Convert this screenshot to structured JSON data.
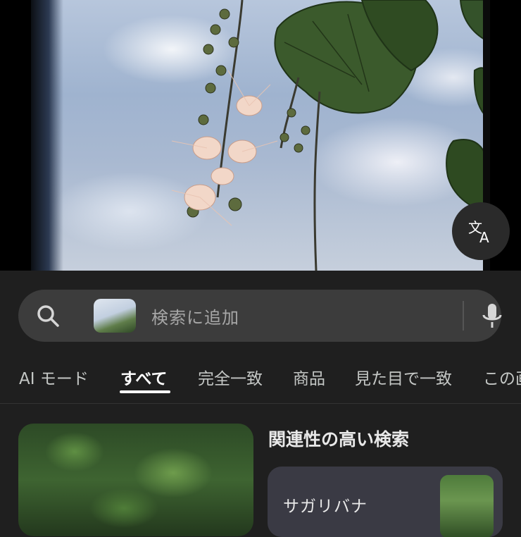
{
  "photo": {
    "subject": "flowering-tree-photo"
  },
  "translate_button": {
    "icon": "translate-icon"
  },
  "search": {
    "placeholder": "検索に追加",
    "icon": "search-icon",
    "mic_icon": "mic-icon"
  },
  "tabs": [
    {
      "label": "AI モード"
    },
    {
      "label": "すべて",
      "active": true
    },
    {
      "label": "完全一致"
    },
    {
      "label": "商品"
    },
    {
      "label": "見た目で一致"
    },
    {
      "label": "この画"
    }
  ],
  "related": {
    "title": "関連性の高い検索",
    "items": [
      {
        "label": "サガリバナ"
      }
    ]
  },
  "colors": {
    "background": "#1f1f1f",
    "search_bar": "#3c3c3c",
    "card": "#3a3a44",
    "active_tab": "#ffffff"
  }
}
